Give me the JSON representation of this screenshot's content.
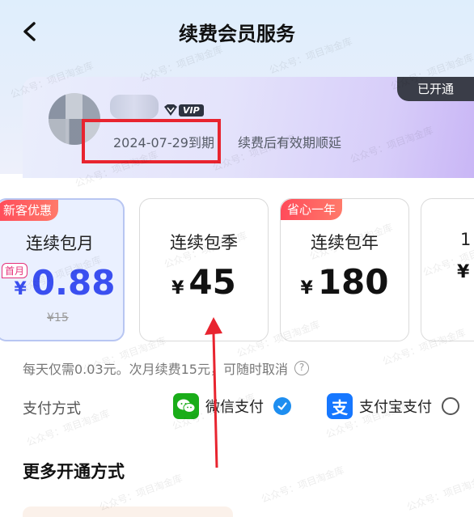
{
  "header": {
    "title": "续费会员服务"
  },
  "member": {
    "status": "已开通",
    "vip_label": "VIP",
    "expire_date": "2024-07-29到期",
    "expire_note": "续费后有效期顺延"
  },
  "plans": [
    {
      "name": "连续包月",
      "yen": "¥",
      "price": "0.88",
      "tag": "新客优惠",
      "first_tag": "首月",
      "original_price": "¥15",
      "selected": true
    },
    {
      "name": "连续包季",
      "yen": "¥",
      "price": "45"
    },
    {
      "name": "连续包年",
      "yen": "¥",
      "price": "180",
      "tag": "省心一年"
    },
    {
      "name": "1",
      "yen": "¥",
      "price": ""
    }
  ],
  "description": "每天仅需0.03元。次月续费15元，可随时取消",
  "payment": {
    "label": "支付方式",
    "options": [
      {
        "name": "微信支付",
        "icon": "wechat-pay-icon",
        "checked": true
      },
      {
        "name": "支付宝支付",
        "icon": "alipay-icon",
        "checked": false
      }
    ]
  },
  "more": {
    "title": "更多开通方式"
  },
  "watermark": "公众号：项目淘金库",
  "colors": {
    "accent_blue": "#3a4ff0",
    "tag_red": "#ff4b5a",
    "highlight_red": "#e8242f",
    "wechat_green": "#1aad19",
    "alipay_blue": "#1677ff",
    "check_blue": "#1e8ef0"
  }
}
